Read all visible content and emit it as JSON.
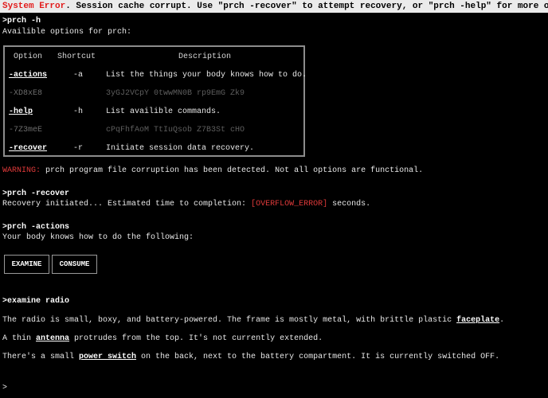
{
  "banner": {
    "error_label": "System Error",
    "message": ". Session cache corrupt. Use \"prch -recover\" to attempt recovery, or \"prch -help\" for more options."
  },
  "terminal": {
    "cmd1": ">prch -h",
    "availible": "Availible options for prch:",
    "table": {
      "headers": [
        "Option",
        "Shortcut",
        "Description"
      ],
      "rows": [
        {
          "option": "-actions",
          "shortcut": "-a",
          "description": "List the things your body knows how to do."
        },
        {
          "option": "-XD8xE8",
          "shortcut": "",
          "description": "3yGJ2VCpY 0twwMN0B rp9EmG Zk9"
        },
        {
          "option": "-help",
          "shortcut": "-h",
          "description": "List availible commands."
        },
        {
          "option": "-7Z3meE",
          "shortcut": "",
          "description": "cPqFhfAoM TtIuQsob Z7B3St cHO"
        },
        {
          "option": "-recover",
          "shortcut": "-r",
          "description": "Initiate session data recovery."
        }
      ]
    },
    "warning_label": "WARNING:",
    "warning_text": " prch program file corruption has been detected. Not all options are functional.",
    "cmd2": ">prch -recover",
    "recovery_prefix": "Recovery initiated... Estimated time to completion: ",
    "recovery_error": "[OVERFLOW_ERROR]",
    "recovery_suffix": " seconds.",
    "cmd3": ">prch -actions",
    "actions_intro": "Your body knows how to do the following:",
    "action_buttons": [
      "EXAMINE",
      "CONSUME"
    ],
    "cmd4": ">examine radio",
    "desc1_pre": "The radio is small, boxy, and battery-powered. The frame is mostly metal, with brittle plastic ",
    "desc1_link": "faceplate",
    "desc1_post": ".",
    "desc2_pre": "A thin ",
    "desc2_link": "antenna",
    "desc2_post": " protrudes from the top. It's not currently extended.",
    "desc3_pre": "There's a small ",
    "desc3_link": "power switch",
    "desc3_post": " on the back, next to the battery compartment. It is currently switched OFF.",
    "prompt": ">"
  }
}
